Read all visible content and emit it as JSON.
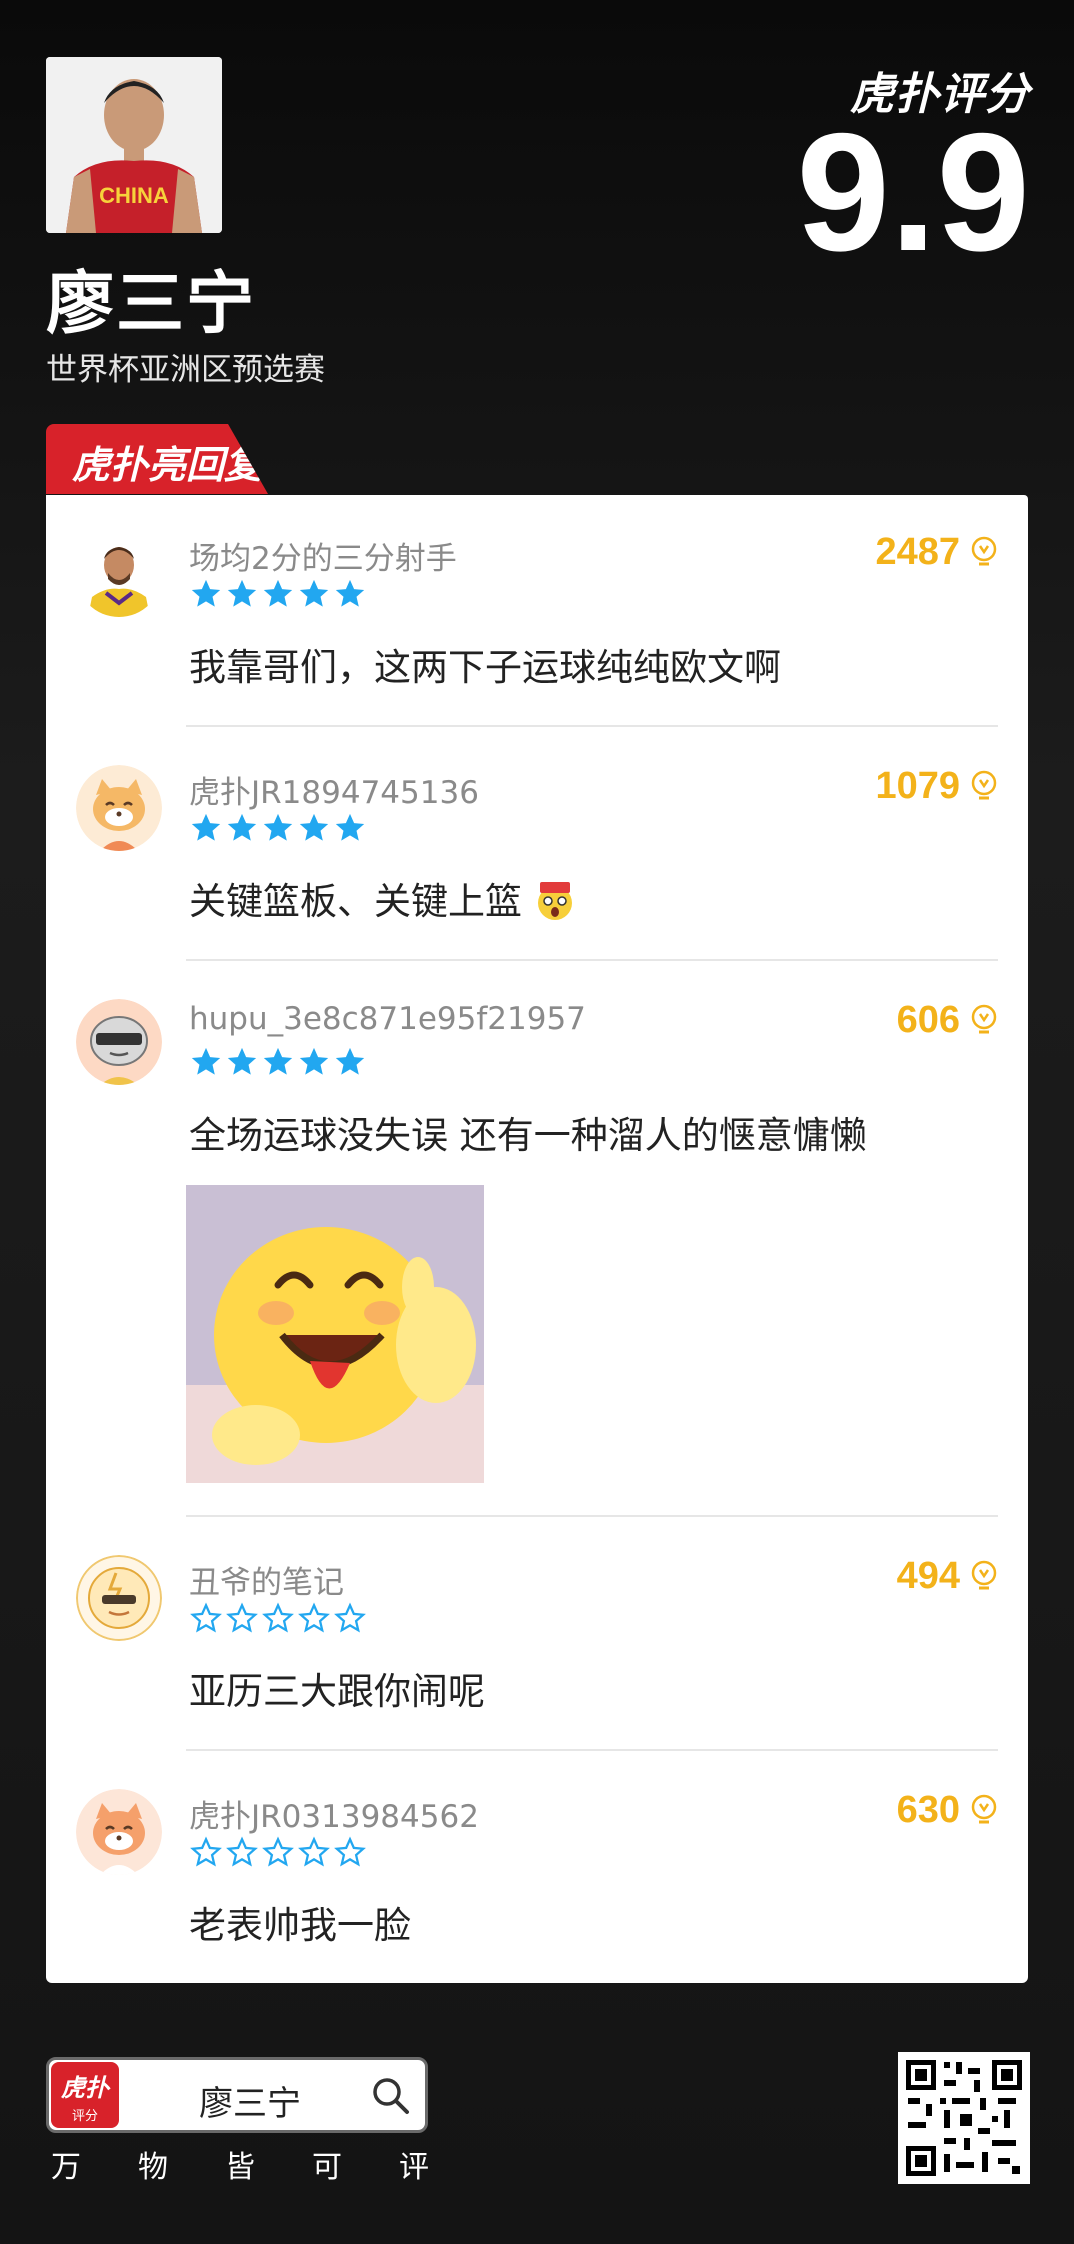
{
  "header": {
    "player_name": "廖三宁",
    "event": "世界杯亚洲区预选赛",
    "brand": "虎扑评分",
    "score": "9.9",
    "jersey_text": "CHINA"
  },
  "section": {
    "tag": "虎扑亮回复"
  },
  "comments": [
    {
      "username": "场均2分的三分射手",
      "likes": "2487",
      "rating": 5,
      "text": "我靠哥们，这两下子运球纯纯欧文啊",
      "avatar": "player-avatar"
    },
    {
      "username": "虎扑JR1894745136",
      "likes": "1079",
      "rating": 5,
      "text": "关键篮板、关键上篮",
      "avatar": "cat-avatar",
      "emoji": "shocked-emoji"
    },
    {
      "username": "hupu_3e8c871e95f21957",
      "likes": "606",
      "rating": 5,
      "text": "全场运球没失误 还有一种溜人的惬意慵懒",
      "avatar": "robot-avatar",
      "image": "thumbs-up-emoji-sticker"
    },
    {
      "username": "丑爷的笔记",
      "likes": "494",
      "rating": 0,
      "text": "亚历三大跟你闹呢",
      "avatar": "tiger-avatar"
    },
    {
      "username": "虎扑JR0313984562",
      "likes": "630",
      "rating": 0,
      "text": "老表帅我一脸",
      "avatar": "cat-avatar"
    }
  ],
  "footer": {
    "logo_line1": "虎扑",
    "logo_line2": "评分",
    "search_text": "廖三宁",
    "slogan": [
      "万",
      "物",
      "皆",
      "可",
      "评"
    ]
  },
  "colors": {
    "accent_red": "#d8222a",
    "likes_gold": "#f3b21a",
    "star_blue": "#22a7f0"
  }
}
